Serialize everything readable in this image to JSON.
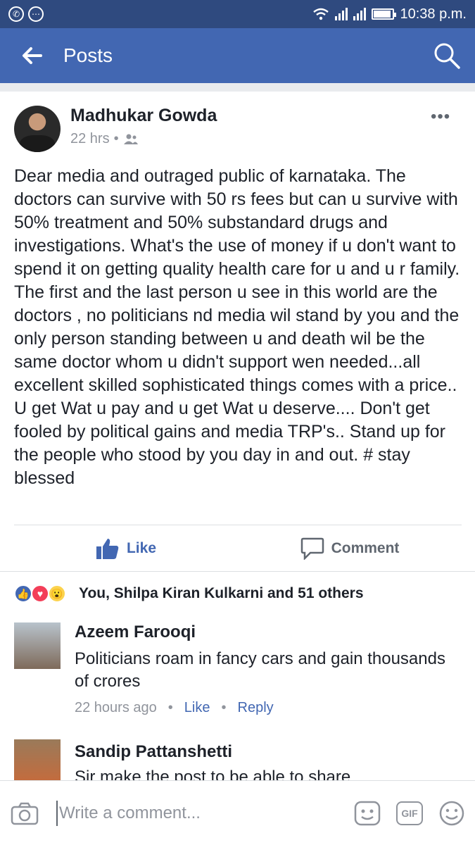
{
  "status_bar": {
    "time": "10:38 p.m."
  },
  "header": {
    "title": "Posts"
  },
  "post": {
    "author": "Madhukar Gowda",
    "time": "22 hrs",
    "text": "Dear media and outraged public of karnataka. The doctors can survive with 50 rs fees but can u survive with 50% treatment and 50% substandard drugs and investigations.  What's the use of money if u don't want to spend it on getting quality health care for u and u r family. The first and the last  person u see in this world are the doctors , no politicians nd media wil stand by you and the only person standing between u and death wil be the same doctor whom u didn't support wen needed...all excellent skilled sophisticated things comes with a price.. U get Wat u pay and u get Wat u deserve.... Don't get fooled by political gains and media TRP's.. Stand up for the people who stood by you day in and out. # stay blessed",
    "like_label": "Like",
    "comment_label": "Comment",
    "reactions_text": "You, Shilpa Kiran Kulkarni and 51 others"
  },
  "comments": [
    {
      "name": "Azeem Farooqi",
      "text": "Politicians roam in fancy cars and gain thousands of crores",
      "time": "22 hours ago",
      "like": "Like",
      "reply": "Reply"
    },
    {
      "name": "Sandip Pattanshetti",
      "text": "Sir make the post to be able to share"
    }
  ],
  "composer": {
    "placeholder": "Write a comment..."
  }
}
